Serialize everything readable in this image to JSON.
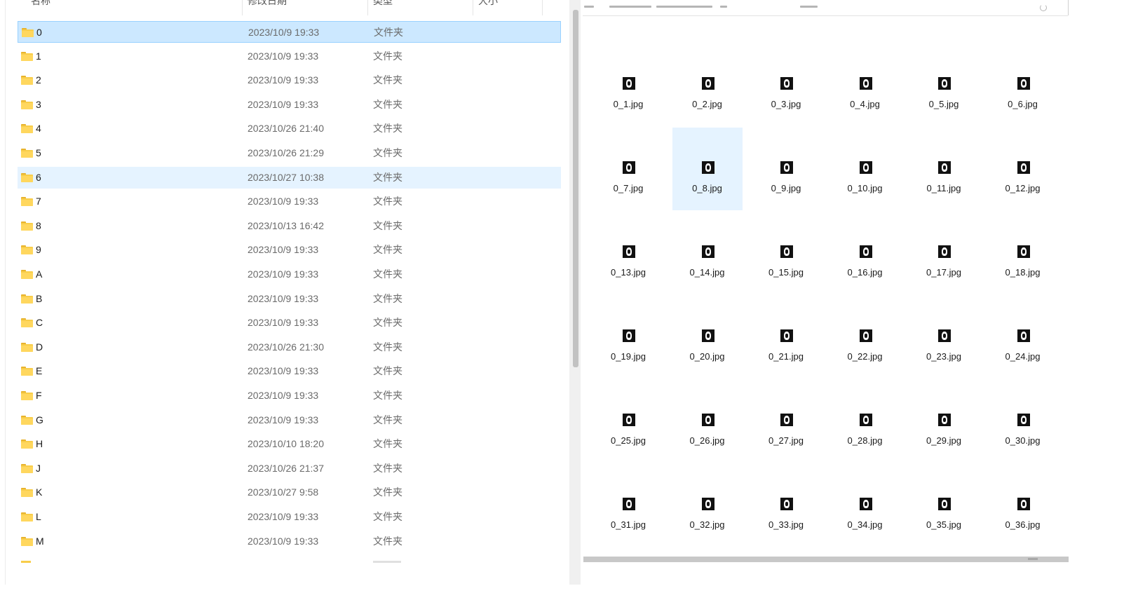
{
  "list_header": {
    "name": "名称",
    "modified": "修改日期",
    "type": "类型",
    "size": "大小"
  },
  "list_rows": [
    {
      "name": "0",
      "date": "2023/10/9 19:33",
      "type": "文件夹",
      "state": "selected"
    },
    {
      "name": "1",
      "date": "2023/10/9 19:33",
      "type": "文件夹",
      "state": ""
    },
    {
      "name": "2",
      "date": "2023/10/9 19:33",
      "type": "文件夹",
      "state": ""
    },
    {
      "name": "3",
      "date": "2023/10/9 19:33",
      "type": "文件夹",
      "state": ""
    },
    {
      "name": "4",
      "date": "2023/10/26 21:40",
      "type": "文件夹",
      "state": ""
    },
    {
      "name": "5",
      "date": "2023/10/26 21:29",
      "type": "文件夹",
      "state": ""
    },
    {
      "name": "6",
      "date": "2023/10/27 10:38",
      "type": "文件夹",
      "state": "hover"
    },
    {
      "name": "7",
      "date": "2023/10/9 19:33",
      "type": "文件夹",
      "state": ""
    },
    {
      "name": "8",
      "date": "2023/10/13 16:42",
      "type": "文件夹",
      "state": ""
    },
    {
      "name": "9",
      "date": "2023/10/9 19:33",
      "type": "文件夹",
      "state": ""
    },
    {
      "name": "A",
      "date": "2023/10/9 19:33",
      "type": "文件夹",
      "state": ""
    },
    {
      "name": "B",
      "date": "2023/10/9 19:33",
      "type": "文件夹",
      "state": ""
    },
    {
      "name": "C",
      "date": "2023/10/9 19:33",
      "type": "文件夹",
      "state": ""
    },
    {
      "name": "D",
      "date": "2023/10/26 21:30",
      "type": "文件夹",
      "state": ""
    },
    {
      "name": "E",
      "date": "2023/10/9 19:33",
      "type": "文件夹",
      "state": ""
    },
    {
      "name": "F",
      "date": "2023/10/9 19:33",
      "type": "文件夹",
      "state": ""
    },
    {
      "name": "G",
      "date": "2023/10/9 19:33",
      "type": "文件夹",
      "state": ""
    },
    {
      "name": "H",
      "date": "2023/10/10 18:20",
      "type": "文件夹",
      "state": ""
    },
    {
      "name": "J",
      "date": "2023/10/26 21:37",
      "type": "文件夹",
      "state": ""
    },
    {
      "name": "K",
      "date": "2023/10/27 9:58",
      "type": "文件夹",
      "state": ""
    },
    {
      "name": "L",
      "date": "2023/10/9 19:33",
      "type": "文件夹",
      "state": ""
    },
    {
      "name": "M",
      "date": "2023/10/9 19:33",
      "type": "文件夹",
      "state": ""
    }
  ],
  "icon_files": [
    {
      "label": "0_1.jpg",
      "state": ""
    },
    {
      "label": "0_2.jpg",
      "state": ""
    },
    {
      "label": "0_3.jpg",
      "state": ""
    },
    {
      "label": "0_4.jpg",
      "state": ""
    },
    {
      "label": "0_5.jpg",
      "state": ""
    },
    {
      "label": "0_6.jpg",
      "state": ""
    },
    {
      "label": "0_7.jpg",
      "state": ""
    },
    {
      "label": "0_8.jpg",
      "state": "hover"
    },
    {
      "label": "0_9.jpg",
      "state": ""
    },
    {
      "label": "0_10.jpg",
      "state": ""
    },
    {
      "label": "0_11.jpg",
      "state": ""
    },
    {
      "label": "0_12.jpg",
      "state": ""
    },
    {
      "label": "0_13.jpg",
      "state": ""
    },
    {
      "label": "0_14.jpg",
      "state": ""
    },
    {
      "label": "0_15.jpg",
      "state": ""
    },
    {
      "label": "0_16.jpg",
      "state": ""
    },
    {
      "label": "0_17.jpg",
      "state": ""
    },
    {
      "label": "0_18.jpg",
      "state": ""
    },
    {
      "label": "0_19.jpg",
      "state": ""
    },
    {
      "label": "0_20.jpg",
      "state": ""
    },
    {
      "label": "0_21.jpg",
      "state": ""
    },
    {
      "label": "0_22.jpg",
      "state": ""
    },
    {
      "label": "0_23.jpg",
      "state": ""
    },
    {
      "label": "0_24.jpg",
      "state": ""
    },
    {
      "label": "0_25.jpg",
      "state": ""
    },
    {
      "label": "0_26.jpg",
      "state": ""
    },
    {
      "label": "0_27.jpg",
      "state": ""
    },
    {
      "label": "0_28.jpg",
      "state": ""
    },
    {
      "label": "0_29.jpg",
      "state": ""
    },
    {
      "label": "0_30.jpg",
      "state": ""
    },
    {
      "label": "0_31.jpg",
      "state": ""
    },
    {
      "label": "0_32.jpg",
      "state": ""
    },
    {
      "label": "0_33.jpg",
      "state": ""
    },
    {
      "label": "0_34.jpg",
      "state": ""
    },
    {
      "label": "0_35.jpg",
      "state": ""
    },
    {
      "label": "0_36.jpg",
      "state": ""
    }
  ],
  "colors": {
    "selected_row": "#cce8ff",
    "hover_row": "#e5f3ff",
    "folder": "#ffd75e",
    "secondary_text": "#6a6a6a"
  },
  "icons": {
    "row_icon": "folder-icon",
    "file_icon": "image-thumbnail-icon"
  }
}
